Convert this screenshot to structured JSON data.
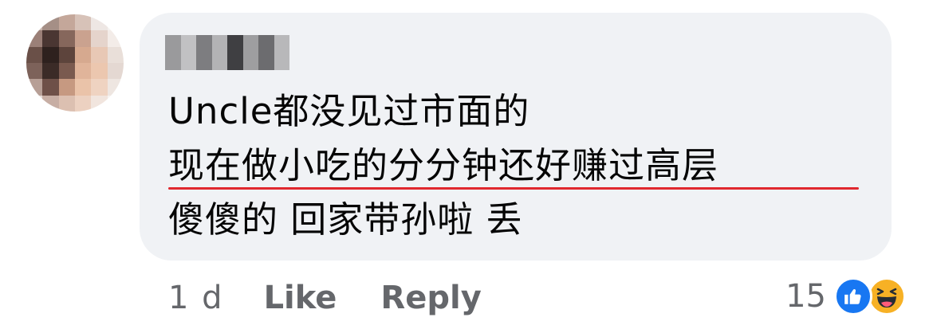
{
  "comment": {
    "lines": [
      "Uncle都没见过市面的",
      "现在做小吃的分分钟还好赚过高层",
      "傻傻的 回家带孙啦 丢"
    ],
    "highlight_color": "#e0282e"
  },
  "footer": {
    "time": "1 d",
    "like_label": "Like",
    "reply_label": "Reply",
    "reaction_count": "15",
    "reaction_icons": [
      "like-icon",
      "haha-icon"
    ]
  },
  "colors": {
    "bubble": "#f0f2f5",
    "text": "#050505",
    "meta": "#65676b",
    "like_blue": "#1877f2",
    "haha_yellow": "#f7b125"
  }
}
